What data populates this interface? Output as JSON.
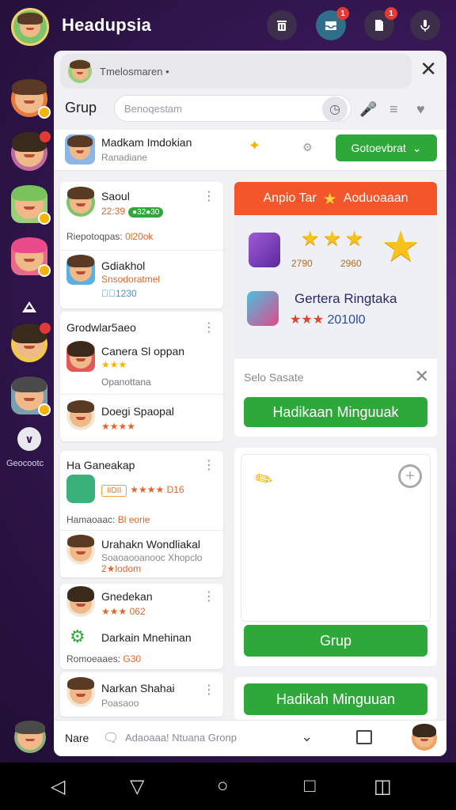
{
  "app": {
    "title": "Headupsia"
  },
  "topbar": {
    "icons": [
      "trash-icon",
      "inbox-icon",
      "document-icon",
      "mic-icon"
    ],
    "badges": [
      "1",
      "1"
    ]
  },
  "rail": {
    "more_label": "Geocootc"
  },
  "panel": {
    "header_text": "Tmelosmaren •",
    "group_label": "Grup",
    "search_placeholder": "Benoqestam",
    "contact": {
      "name": "Madkam Imdokian",
      "sub": "Ranadiane",
      "follow_label": "Gotoevbrat"
    }
  },
  "left_col": {
    "card1": {
      "item1_title": "Saoul",
      "item1_meta": "22:39",
      "item1_pill": "●32●30",
      "line1_label": "Riepotoqpas:",
      "line1_value": "0l20ok",
      "item2_title": "Gdiakhol",
      "item2_sub": "Snsodoratmel",
      "item2_meta": "✱⃣1230"
    },
    "card2": {
      "section_title": "Grodwlar5aeo",
      "item1_title": "Canera Sl oppan",
      "item1_meta": "★★★",
      "item1_sub": "Opanottana",
      "item2_title": "Doegi Spaopal",
      "item2_meta": "★★★★"
    },
    "card3": {
      "section_title": "Ha Ganeakap",
      "tag": "IIDII",
      "tag_meta": "★★★★ D16",
      "line1_label": "Hamaoaac:",
      "line1_value": "Bl eorie",
      "item1_title": "Urahakn Wondliakal",
      "item1_sub": "Soaoaooanooc Xhopclo",
      "item1_meta": "2★lodom"
    },
    "card4": {
      "item1_title": "Gnedekan",
      "item1_meta": "★★★ 062",
      "item2_title": "Darkain Mnehinan",
      "line1_label": "Romoeaaes:",
      "line1_value": "G30"
    },
    "card5": {
      "item1_title": "Narkan Shahai",
      "item1_sub": "Poasaoo"
    }
  },
  "promo": {
    "header": "Anpio Tar",
    "header_right": "Aoduoaaan",
    "stat1": "2790",
    "stat2": "2960",
    "title": "Gertera Ringtaka",
    "rating": "★★★",
    "rating_value": "2010l0",
    "sub_label": "Selo Sasate",
    "cta": "Hadikaan Minguuak"
  },
  "blank_card": {
    "cta": "Grup"
  },
  "bottom_card": {
    "cta": "Hadikah Minguuan"
  },
  "composer": {
    "label": "Nare",
    "placeholder": "Adaoaaa! Ntuana Gronp"
  },
  "colors": {
    "accent_green": "#2fa83a",
    "accent_orange": "#f2562a",
    "star": "#f7c21b",
    "bg_purple": "#3a1a5c"
  }
}
